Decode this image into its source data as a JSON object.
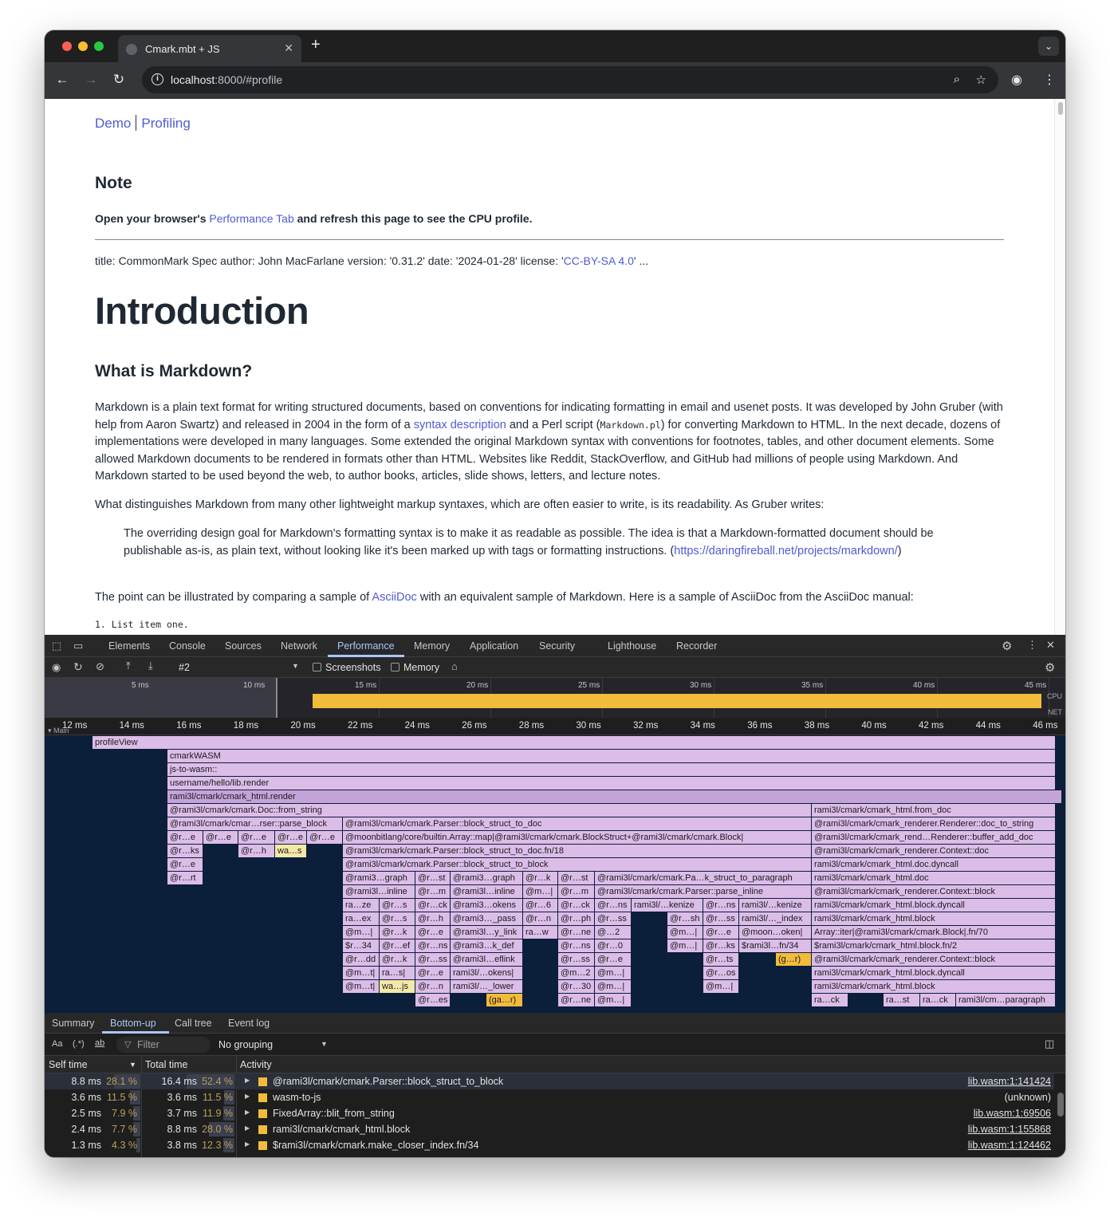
{
  "browser": {
    "tab_title": "Cmark.mbt + JS",
    "url_host": "localhost",
    "url_rest": ":8000/#profile"
  },
  "page": {
    "nav": {
      "demo": "Demo",
      "profiling": "Profiling"
    },
    "note_heading": "Note",
    "note_pre": "Open your browser's ",
    "note_link": "Performance Tab",
    "note_post": " and refresh this page to see the CPU profile.",
    "meta_pre": "title: CommonMark Spec author: John MacFarlane version: '0.31.2' date: '2024-01-28' license: '",
    "meta_link": "CC-BY-SA 4.0",
    "meta_post": "' ...",
    "intro_heading": "Introduction",
    "what_heading": "What is Markdown?",
    "p1_a": "Markdown is a plain text format for writing structured documents, based on conventions for indicating formatting in email and usenet posts. It was developed by John Gruber (with help from Aaron Swartz) and released in 2004 in the form of a ",
    "p1_link": "syntax description",
    "p1_b": " and a Perl script (",
    "p1_code": "Markdown.pl",
    "p1_c": ") for converting Markdown to HTML. In the next decade, dozens of implementations were developed in many languages. Some extended the original Markdown syntax with conventions for footnotes, tables, and other document elements. Some allowed Markdown documents to be rendered in formats other than HTML. Websites like Reddit, StackOverflow, and GitHub had millions of people using Markdown. And Markdown started to be used beyond the web, to author books, articles, slide shows, letters, and lecture notes.",
    "p2": "What distinguishes Markdown from many other lightweight markup syntaxes, which are often easier to write, is its readability. As Gruber writes:",
    "quote_a": "The overriding design goal for Markdown's formatting syntax is to make it as readable as possible. The idea is that a Markdown-formatted document should be publishable as-is, as plain text, without looking like it's been marked up with tags or formatting instructions. (",
    "quote_link": "https://daringfireball.net/projects/markdown/",
    "quote_b": ")",
    "p3_a": "The point can be illustrated by comparing a sample of ",
    "p3_link": "AsciiDoc",
    "p3_b": " with an equivalent sample of Markdown. Here is a sample of AsciiDoc from the AsciiDoc manual:",
    "list_code": "1. List item one."
  },
  "devtools": {
    "tabs": [
      "Elements",
      "Console",
      "Sources",
      "Network",
      "Performance",
      "Memory",
      "Application",
      "Security",
      "Lighthouse",
      "Recorder"
    ],
    "active_tab": "Performance",
    "recording": "#2",
    "screenshots_label": "Screenshots",
    "memory_label": "Memory",
    "overview_ticks": [
      "5 ms",
      "10 ms",
      "15 ms",
      "20 ms",
      "25 ms",
      "30 ms",
      "35 ms",
      "40 ms",
      "45 ms"
    ],
    "cpu_label": "CPU",
    "net_label": "NET",
    "ruler_ticks": [
      "12 ms",
      "14 ms",
      "16 ms",
      "18 ms",
      "20 ms",
      "22 ms",
      "24 ms",
      "26 ms",
      "28 ms",
      "30 ms",
      "32 ms",
      "34 ms",
      "36 ms",
      "38 ms",
      "40 ms",
      "42 ms",
      "44 ms",
      "46 ms"
    ],
    "main_label": "Main",
    "flame_rows": [
      [
        [
          "profileView",
          60,
          1268,
          "n"
        ]
      ],
      [
        [
          "cmarkWASM",
          154,
          1268,
          "n"
        ]
      ],
      [
        [
          "js-to-wasm::",
          154,
          1268,
          "n"
        ]
      ],
      [
        [
          "username/hello/lib.render",
          154,
          1268,
          "n"
        ]
      ],
      [
        [
          "rami3l/cmark/cmark_html.render",
          154,
          1276,
          "d"
        ]
      ],
      [
        [
          "@rami3l/cmark/cmark.Doc::from_string",
          154,
          962,
          "n"
        ],
        [
          "rami3l/cmark/cmark_html.from_doc",
          962,
          1268,
          "n"
        ]
      ],
      [
        [
          "@rami3l/cmark/cmar…rser::parse_block",
          154,
          374,
          "n"
        ],
        [
          "@rami3l/cmark/cmark.Parser::block_struct_to_doc",
          374,
          962,
          "n"
        ],
        [
          "@rami3l/cmark/cmark_renderer.Renderer::doc_to_string",
          962,
          1268,
          "n"
        ]
      ],
      [
        [
          "@r…e",
          154,
          199,
          "n"
        ],
        [
          "@r…e",
          199,
          243,
          "n"
        ],
        [
          "@r…e",
          243,
          289,
          "n"
        ],
        [
          "@r…e",
          289,
          329,
          "n"
        ],
        [
          "@r…e",
          329,
          374,
          "n"
        ],
        [
          "@moonbitlang/core/builtin.Array::map|@rami3l/cmark/cmark.BlockStruct+@rami3l/cmark/cmark.Block|",
          374,
          962,
          "n"
        ],
        [
          "@rami3l/cmark/cmark_rend…Renderer::buffer_add_doc",
          962,
          1268,
          "n"
        ]
      ],
      [
        [
          "@r…ks",
          154,
          199,
          "n"
        ],
        [
          "@r…h",
          243,
          289,
          "n"
        ],
        [
          "wa…s",
          289,
          329,
          "c"
        ],
        [
          "@rami3l/cmark/cmark.Parser::block_struct_to_doc.fn/18",
          374,
          962,
          "n"
        ],
        [
          "@rami3l/cmark/cmark_renderer.Context::doc",
          962,
          1268,
          "n"
        ]
      ],
      [
        [
          "@r…e",
          154,
          199,
          "n"
        ],
        [
          "@rami3l/cmark/cmark.Parser::block_struct_to_block",
          374,
          962,
          "n"
        ],
        [
          "rami3l/cmark/cmark_html.doc.dyncall",
          962,
          1268,
          "n"
        ]
      ],
      [
        [
          "@r…rt",
          154,
          199,
          "n"
        ],
        [
          "@rami3…graph",
          374,
          465,
          "n"
        ],
        [
          "@r…st",
          465,
          509,
          "n"
        ],
        [
          "@rami3…graph",
          509,
          600,
          "n"
        ],
        [
          "@r…k",
          600,
          644,
          "n"
        ],
        [
          "@r…st",
          644,
          690,
          "n"
        ],
        [
          "@rami3l/cmark/cmark.Pa…k_struct_to_paragraph",
          690,
          962,
          "n"
        ],
        [
          "rami3l/cmark/cmark_html.doc",
          962,
          1268,
          "n"
        ]
      ],
      [
        [
          "@rami3l…inline",
          374,
          465,
          "n"
        ],
        [
          "@r…m",
          465,
          509,
          "n"
        ],
        [
          "@rami3l…inline",
          509,
          600,
          "n"
        ],
        [
          "@m…|",
          600,
          644,
          "n"
        ],
        [
          "@r…m",
          644,
          690,
          "n"
        ],
        [
          "@rami3l/cmark/cmark.Parser::parse_inline",
          690,
          962,
          "n"
        ],
        [
          "@rami3l/cmark/cmark_renderer.Context::block",
          962,
          1268,
          "n"
        ]
      ],
      [
        [
          "ra…ze",
          374,
          420,
          "n"
        ],
        [
          "@r…s",
          420,
          465,
          "n"
        ],
        [
          "@r…ck",
          465,
          509,
          "n"
        ],
        [
          "@rami3…okens",
          509,
          600,
          "n"
        ],
        [
          "@r…6",
          600,
          644,
          "n"
        ],
        [
          "@r…ck",
          644,
          690,
          "n"
        ],
        [
          "@r…ns",
          690,
          736,
          "n"
        ],
        [
          "rami3l/…kenize",
          736,
          826,
          "n"
        ],
        [
          "@r…ns",
          826,
          871,
          "n"
        ],
        [
          "rami3l/…kenize",
          871,
          962,
          "n"
        ],
        [
          "rami3l/cmark/cmark_html.block.dyncall",
          962,
          1268,
          "n"
        ]
      ],
      [
        [
          "ra…ex",
          374,
          420,
          "n"
        ],
        [
          "@r…s",
          420,
          465,
          "n"
        ],
        [
          "@r…h",
          465,
          509,
          "n"
        ],
        [
          "@rami3…_pass",
          509,
          600,
          "n"
        ],
        [
          "@r…n",
          600,
          644,
          "n"
        ],
        [
          "@r…ph",
          644,
          690,
          "n"
        ],
        [
          "@r…ss",
          690,
          736,
          "n"
        ],
        [
          "@r…sh",
          781,
          826,
          "n"
        ],
        [
          "@r…ss",
          826,
          871,
          "n"
        ],
        [
          "rami3l/…_index",
          871,
          962,
          "n"
        ],
        [
          "rami3l/cmark/cmark_html.block",
          962,
          1268,
          "n"
        ]
      ],
      [
        [
          "@m…|",
          374,
          420,
          "n"
        ],
        [
          "@r…k",
          420,
          465,
          "n"
        ],
        [
          "@r…e",
          465,
          509,
          "n"
        ],
        [
          "@rami3l…y_link",
          509,
          600,
          "n"
        ],
        [
          "ra…w",
          600,
          644,
          "n"
        ],
        [
          "@r…ne",
          644,
          690,
          "n"
        ],
        [
          "@…2",
          690,
          736,
          "n"
        ],
        [
          "@m…|",
          781,
          826,
          "n"
        ],
        [
          "@r…e",
          826,
          871,
          "n"
        ],
        [
          "@moon…oken|",
          871,
          962,
          "n"
        ],
        [
          "Array::iter|@rami3l/cmark/cmark.Block|.fn/70",
          962,
          1268,
          "n"
        ]
      ],
      [
        [
          "$r…34",
          374,
          420,
          "n"
        ],
        [
          "@r…ef",
          420,
          465,
          "n"
        ],
        [
          "@r…ns",
          465,
          509,
          "n"
        ],
        [
          "@rami3…k_def",
          509,
          600,
          "n"
        ],
        [
          "@r…ns",
          644,
          690,
          "n"
        ],
        [
          "@r…0",
          690,
          736,
          "n"
        ],
        [
          "@m…|",
          781,
          826,
          "n"
        ],
        [
          "@r…ks",
          826,
          871,
          "n"
        ],
        [
          "$rami3l…fn/34",
          871,
          962,
          "n"
        ],
        [
          "$rami3l/cmark/cmark_html.block.fn/2",
          962,
          1268,
          "n"
        ]
      ],
      [
        [
          "@r…dd",
          374,
          420,
          "n"
        ],
        [
          "@r…k",
          420,
          465,
          "n"
        ],
        [
          "@r…ss",
          465,
          509,
          "n"
        ],
        [
          "@rami3l…eflink",
          509,
          600,
          "n"
        ],
        [
          "@r…ss",
          644,
          690,
          "n"
        ],
        [
          "@r…e",
          690,
          736,
          "n"
        ],
        [
          "@r…ts",
          826,
          871,
          "n"
        ],
        [
          "(g…r)",
          917,
          962,
          "y"
        ],
        [
          "@rami3l/cmark/cmark_renderer.Context::block",
          962,
          1268,
          "n"
        ]
      ],
      [
        [
          "@m…t|",
          374,
          420,
          "n"
        ],
        [
          "ra…s|",
          420,
          465,
          "n"
        ],
        [
          "@r…e",
          465,
          509,
          "n"
        ],
        [
          "rami3l/…okens|",
          509,
          600,
          "n"
        ],
        [
          "@m…2",
          644,
          690,
          "n"
        ],
        [
          "@m…|",
          690,
          736,
          "n"
        ],
        [
          "@r…os",
          826,
          871,
          "n"
        ],
        [
          "rami3l/cmark/cmark_html.block.dyncall",
          962,
          1268,
          "n"
        ]
      ],
      [
        [
          "@m…t|",
          374,
          420,
          "n"
        ],
        [
          "wa…js",
          420,
          465,
          "c"
        ],
        [
          "@r…n",
          465,
          509,
          "n"
        ],
        [
          "rami3l/…_lower",
          509,
          600,
          "n"
        ],
        [
          "@r…30",
          644,
          690,
          "n"
        ],
        [
          "@m…|",
          690,
          736,
          "n"
        ],
        [
          "@m…|",
          826,
          871,
          "n"
        ],
        [
          "rami3l/cmark/cmark_html.block",
          962,
          1268,
          "n"
        ]
      ],
      [
        [
          "@r…es",
          465,
          509,
          "n"
        ],
        [
          "(ga…r)",
          554,
          600,
          "y"
        ],
        [
          "@r…ne",
          644,
          690,
          "n"
        ],
        [
          "@m…|",
          690,
          736,
          "n"
        ],
        [
          "ra…ck",
          962,
          1008,
          "n"
        ],
        [
          "ra…st",
          1052,
          1098,
          "n"
        ],
        [
          "ra…ck",
          1098,
          1143,
          "n"
        ],
        [
          "rami3l/cm…paragraph",
          1143,
          1268,
          "n"
        ]
      ]
    ],
    "panel_tabs": [
      "Summary",
      "Bottom-up",
      "Call tree",
      "Event log"
    ],
    "active_panel": "Bottom-up",
    "filter_placeholder": "Filter",
    "grouping": "No grouping",
    "col_self": "Self time",
    "col_total": "Total time",
    "col_activity": "Activity",
    "rows": [
      {
        "self": "8.8 ms",
        "self_pct": "28.1 %",
        "total": "16.4 ms",
        "total_pct": "52.4 %",
        "activity": "@rami3l/cmark/cmark.Parser::block_struct_to_block",
        "source": "lib.wasm:1:141424"
      },
      {
        "self": "3.6 ms",
        "self_pct": "11.5 %",
        "total": "3.6 ms",
        "total_pct": "11.5 %",
        "activity": "wasm-to-js",
        "source": "(unknown)"
      },
      {
        "self": "2.5 ms",
        "self_pct": "7.9 %",
        "total": "3.7 ms",
        "total_pct": "11.9 %",
        "activity": "FixedArray::blit_from_string",
        "source": "lib.wasm:1:69506"
      },
      {
        "self": "2.4 ms",
        "self_pct": "7.7 %",
        "total": "8.8 ms",
        "total_pct": "28.0 %",
        "activity": "rami3l/cmark/cmark_html.block",
        "source": "lib.wasm:1:155868"
      },
      {
        "self": "1.3 ms",
        "self_pct": "4.3 %",
        "total": "3.8 ms",
        "total_pct": "12.3 %",
        "activity": "$rami3l/cmark/cmark.make_closer_index.fn/34",
        "source": "lib.wasm:1:124462"
      }
    ]
  }
}
